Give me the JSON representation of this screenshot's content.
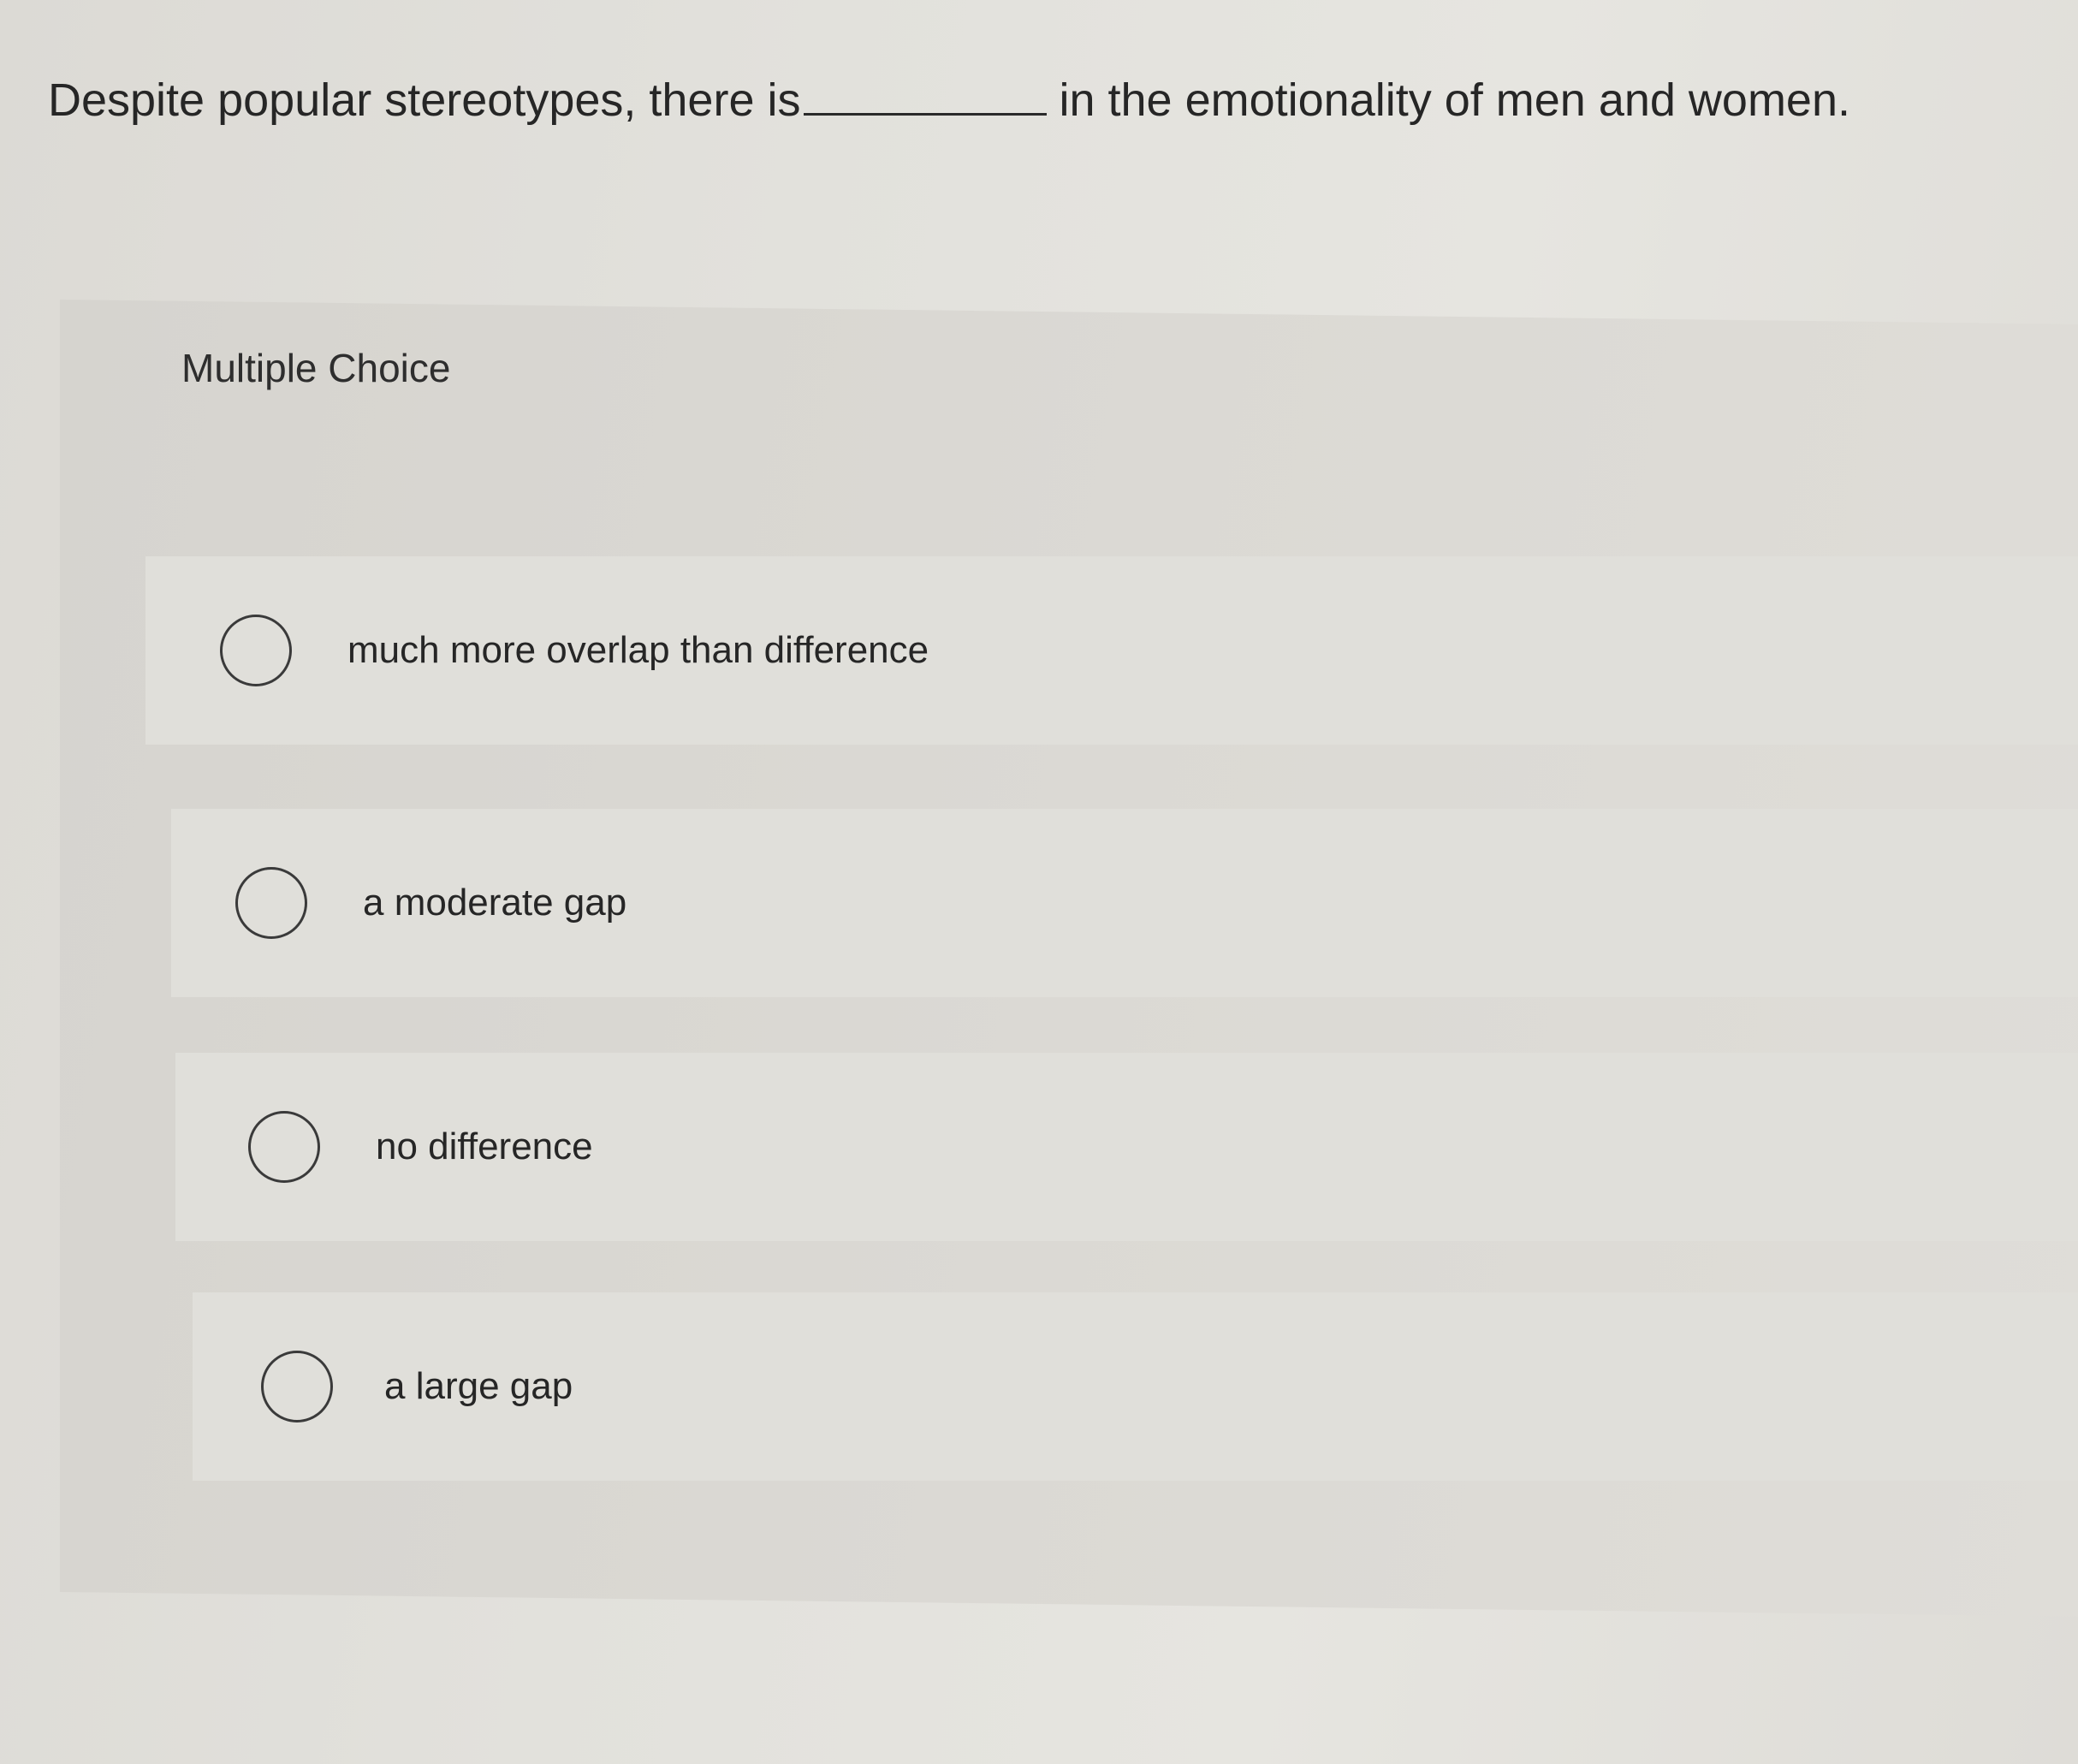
{
  "question": {
    "before_blank": "Despite popular stereotypes, there is",
    "after_blank": "in the emotionality of men and women."
  },
  "multiple_choice": {
    "label": "Multiple Choice",
    "options": [
      {
        "text": "much more overlap than difference",
        "selected": false
      },
      {
        "text": "a moderate gap",
        "selected": false
      },
      {
        "text": "no difference",
        "selected": false
      },
      {
        "text": "a large gap",
        "selected": false
      }
    ]
  }
}
